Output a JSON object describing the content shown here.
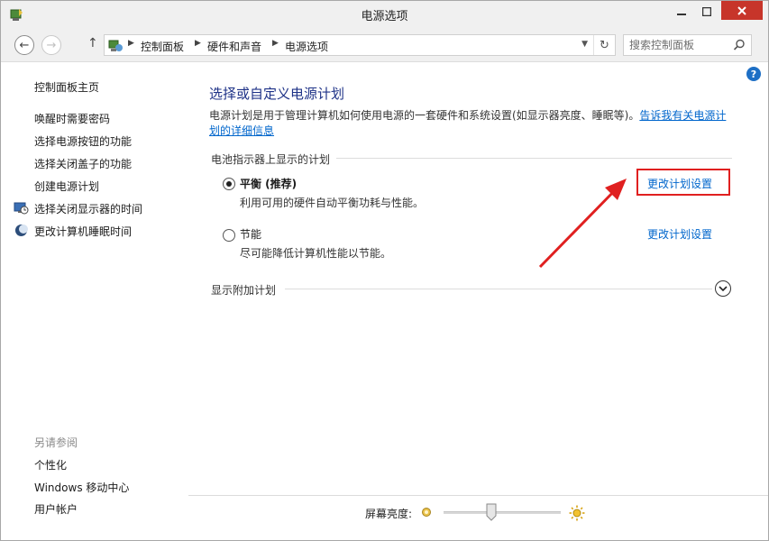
{
  "window": {
    "title": "电源选项"
  },
  "nav": {
    "breadcrumbs": [
      "控制面板",
      "硬件和声音",
      "电源选项"
    ],
    "search_placeholder": "搜索控制面板"
  },
  "sidebar": {
    "items": [
      {
        "label": "控制面板主页"
      },
      {
        "label": "唤醒时需要密码"
      },
      {
        "label": "选择电源按钮的功能"
      },
      {
        "label": "选择关闭盖子的功能"
      },
      {
        "label": "创建电源计划"
      },
      {
        "label": "选择关闭显示器的时间",
        "icon": "monitor-clock-icon"
      },
      {
        "label": "更改计算机睡眠时间",
        "icon": "moon-icon"
      }
    ],
    "see_also_title": "另请参阅",
    "see_also": [
      {
        "label": "个性化"
      },
      {
        "label": "Windows 移动中心"
      },
      {
        "label": "用户帐户"
      }
    ]
  },
  "main": {
    "title": "选择或自定义电源计划",
    "description": "电源计划是用于管理计算机如何使用电源的一套硬件和系统设置(如显示器亮度、睡眠等)。",
    "description_link": "告诉我有关电源计划的详细信息",
    "group_title": "电池指示器上显示的计划",
    "plans": [
      {
        "name": "平衡 (推荐)",
        "description": "利用可用的硬件自动平衡功耗与性能。",
        "selected": true,
        "link": "更改计划设置"
      },
      {
        "name": "节能",
        "description": "尽可能降低计算机性能以节能。",
        "selected": false,
        "link": "更改计划设置"
      }
    ],
    "extra_plans": "显示附加计划"
  },
  "brightness": {
    "label": "屏幕亮度:",
    "level": 0.4
  },
  "colors": {
    "title": "#1e3287",
    "link": "#0066cc",
    "annotation": "#e02020",
    "close": "#c7352a"
  }
}
